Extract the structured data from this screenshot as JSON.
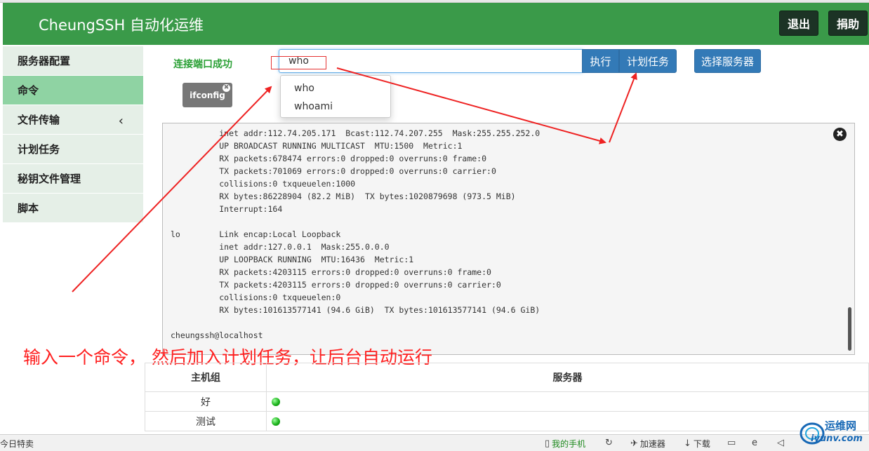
{
  "header": {
    "brand": "CheungSSH 自动化运维",
    "logout_label": "退出",
    "donate_label": "捐助",
    "bg_color": "#3a9a49"
  },
  "sidebar": {
    "items": [
      {
        "label": "服务器配置",
        "active": false
      },
      {
        "label": "命令",
        "active": true
      },
      {
        "label": "文件传输",
        "active": false,
        "has_chevron": true
      },
      {
        "label": "计划任务",
        "active": false
      },
      {
        "label": "秘钥文件管理",
        "active": false
      },
      {
        "label": "脚本",
        "active": false
      }
    ],
    "chevron": "‹"
  },
  "command": {
    "status": "连接端口成功",
    "input_value": "who",
    "execute_label": "执行",
    "schedule_label": "计划任务",
    "select_server_label": "选择服务器",
    "suggestions": [
      "who",
      "whoami"
    ]
  },
  "history_chip": {
    "label": "ifconfig",
    "close_icon": "✖"
  },
  "console": {
    "close_icon": "✖",
    "lines": [
      "          inet addr:112.74.205.171  Bcast:112.74.207.255  Mask:255.255.252.0",
      "          UP BROADCAST RUNNING MULTICAST  MTU:1500  Metric:1",
      "          RX packets:678474 errors:0 dropped:0 overruns:0 frame:0",
      "          TX packets:701069 errors:0 dropped:0 overruns:0 carrier:0",
      "          collisions:0 txqueuelen:1000",
      "          RX bytes:86228904 (82.2 MiB)  TX bytes:1020879698 (973.5 MiB)",
      "          Interrupt:164",
      "",
      "lo        Link encap:Local Loopback",
      "          inet addr:127.0.0.1  Mask:255.0.0.0",
      "          UP LOOPBACK RUNNING  MTU:16436  Metric:1",
      "          RX packets:4203115 errors:0 dropped:0 overruns:0 frame:0",
      "          TX packets:4203115 errors:0 dropped:0 overruns:0 carrier:0",
      "          collisions:0 txqueuelen:0",
      "          RX bytes:101613577141 (94.6 GiB)  TX bytes:101613577141 (94.6 GiB)",
      "",
      "cheungssh@localhost"
    ]
  },
  "annotation": {
    "text": "输入一个命令，  然后加入计划任务，让后台自动运行",
    "color": "#ff1f1f"
  },
  "table": {
    "headers": [
      "主机组",
      "服务器"
    ],
    "rows": [
      {
        "group": "好",
        "status": "online"
      },
      {
        "group": "测试",
        "status": "online"
      }
    ]
  },
  "statusbar": {
    "left_text": "今日特卖",
    "phone": "我的手机",
    "accelerator": "加速器",
    "download": "下载"
  },
  "watermark": {
    "text": "运维网",
    "url": "iyunv.com"
  }
}
